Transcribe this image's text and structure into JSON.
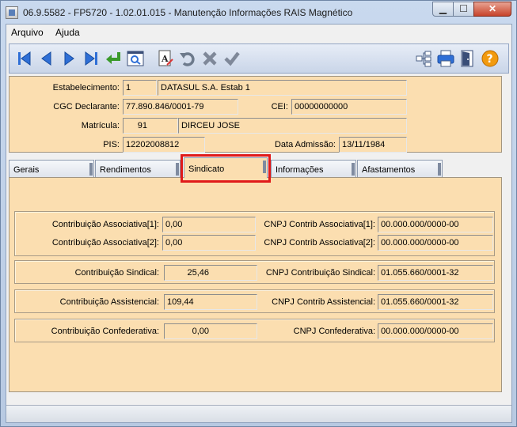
{
  "window": {
    "title": "06.9.5582 - FP5720 - 1.02.01.015 - Manutenção Informações RAIS Magnético"
  },
  "menu": {
    "items": [
      "Arquivo",
      "Ajuda"
    ]
  },
  "toolbar": {
    "icons": [
      "first-record-icon",
      "previous-record-icon",
      "next-record-icon",
      "last-record-icon",
      "goto-record-icon",
      "search-icon",
      "edit-icon",
      "undo-icon",
      "delete-icon",
      "save-icon",
      "tree-icon",
      "print-icon",
      "exit-icon",
      "help-icon"
    ],
    "help_glyph": "?"
  },
  "form": {
    "estabelecimento": {
      "label": "Estabelecimento:",
      "code": "1",
      "name": "DATASUL S.A. Estab 1"
    },
    "cgc": {
      "label": "CGC Declarante:",
      "value": "77.890.846/0001-79"
    },
    "cei": {
      "label": "CEI:",
      "value": "00000000000"
    },
    "matricula": {
      "label": "Matrícula:",
      "code": "91",
      "name": "DIRCEU JOSE"
    },
    "pis": {
      "label": "PIS:",
      "value": "12202008812"
    },
    "admissao": {
      "label": "Data Admissão:",
      "value": "13/11/1984"
    }
  },
  "tabs": [
    "Gerais",
    "Rendimentos",
    "Sindicato",
    "Informações",
    "Afastamentos"
  ],
  "active_tab": "Sindicato",
  "sindicato": {
    "assoc1": {
      "label": "Contribuição Associativa[1]:",
      "value": "0,00",
      "cnpj_label": "CNPJ Contrib Associativa[1]:",
      "cnpj": "00.000.000/0000-00"
    },
    "assoc2": {
      "label": "Contribuição Associativa[2]:",
      "value": "0,00",
      "cnpj_label": "CNPJ Contrib Associativa[2]:",
      "cnpj": "00.000.000/0000-00"
    },
    "sindical": {
      "label": "Contribuição Sindical:",
      "value": "25,46",
      "cnpj_label": "CNPJ Contribuição Sindical:",
      "cnpj": "01.055.660/0001-32"
    },
    "assistencial": {
      "label": "Contribuição Assistencial:",
      "value": "109,44",
      "cnpj_label": "CNPJ Contrib Assistencial:",
      "cnpj": "01.055.660/0001-32"
    },
    "confederativa": {
      "label": "Contribuição Confederativa:",
      "value": "0,00",
      "cnpj_label": "CNPJ Confederativa:",
      "cnpj": "00.000.000/0000-00"
    }
  },
  "colors": {
    "form_bg": "#fbdeb0",
    "toolbar_blue": "#2f6fd6",
    "help_orange": "#f29a0e",
    "highlight_red": "#e01a1a"
  }
}
